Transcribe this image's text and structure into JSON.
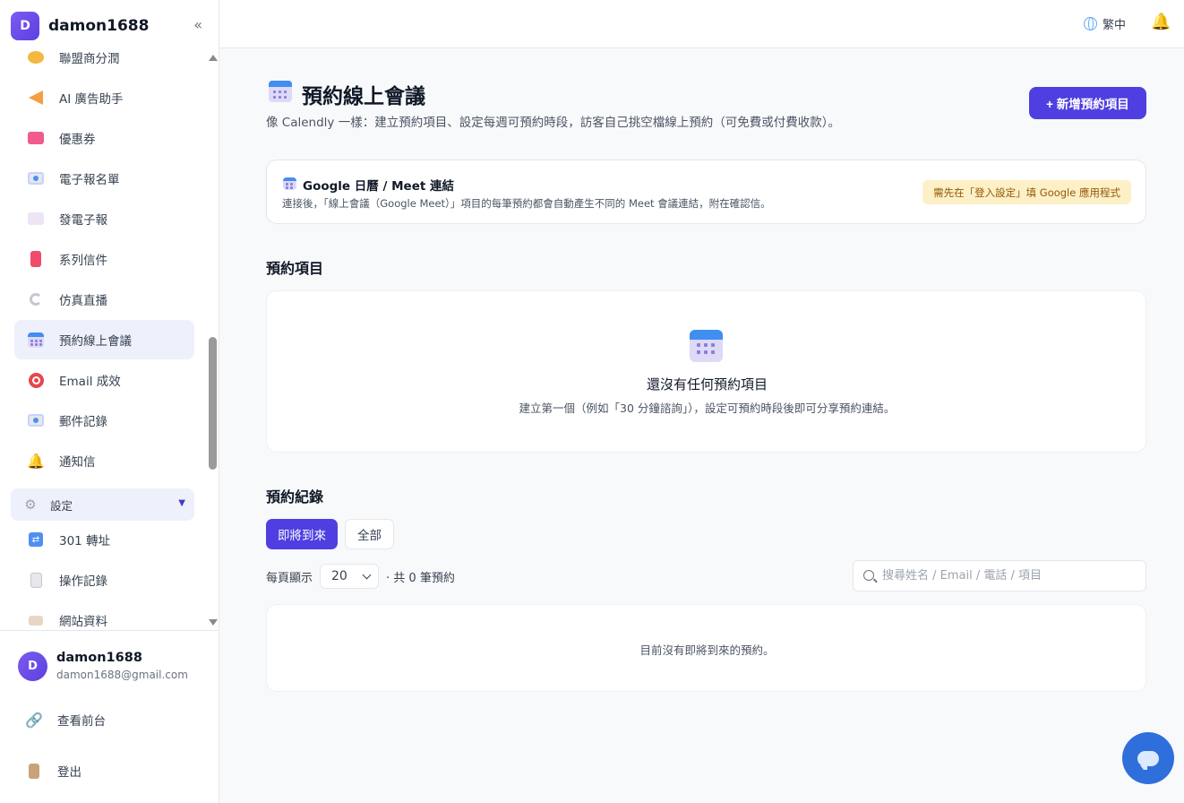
{
  "brand": {
    "initial": "D",
    "name": "damon1688"
  },
  "sidebar": {
    "items": [
      {
        "label": "聯盟商分潤",
        "icon": "handshake-icon",
        "color": "#f4b740"
      },
      {
        "label": "AI 廣告助手",
        "icon": "megaphone-icon",
        "color": "#f59e42"
      },
      {
        "label": "優惠券",
        "icon": "ticket-icon",
        "color": "#ef5b8c"
      },
      {
        "label": "電子報名單",
        "icon": "email-list-icon",
        "color": "#8ab4f8"
      },
      {
        "label": "發電子報",
        "icon": "envelope-icon",
        "color": "#e9d5f5"
      },
      {
        "label": "系列信件",
        "icon": "mailbox-icon",
        "color": "#ef4b6b"
      },
      {
        "label": "仿真直播",
        "icon": "satellite-icon",
        "color": "#9ca3af"
      },
      {
        "label": "預約線上會議",
        "icon": "calendar-icon",
        "color": "#6c6fe6",
        "active": true
      },
      {
        "label": "Email 成效",
        "icon": "target-icon",
        "color": "#e5484d"
      },
      {
        "label": "郵件記錄",
        "icon": "email-log-icon",
        "color": "#8ab4f8"
      },
      {
        "label": "通知信",
        "icon": "bell-icon",
        "color": "#f5b014"
      }
    ],
    "group": {
      "label": "設定",
      "icon": "gear-icon"
    },
    "sub_items": [
      {
        "label": "301 轉址",
        "icon": "shuffle-icon",
        "color": "#4f8ff0"
      },
      {
        "label": "操作記錄",
        "icon": "clipboard-icon",
        "color": "#9ca3af"
      },
      {
        "label": "網站資料",
        "icon": "signpost-icon",
        "color": "#c9a27a"
      }
    ]
  },
  "profile": {
    "initial": "D",
    "name": "damon1688",
    "email": "damon1688@gmail.com",
    "view_front": "查看前台",
    "logout": "登出"
  },
  "topbar": {
    "language": "繁中"
  },
  "page": {
    "title": "預約線上會議",
    "description": "像 Calendly 一樣：建立預約項目、設定每週可預約時段，訪客自己挑空檔線上預約（可免費或付費收款）。",
    "add_button": "+ 新增預約項目"
  },
  "google_card": {
    "title": "Google 日曆 / Meet 連結",
    "description": "連接後，「線上會議（Google Meet）」項目的每筆預約都會自動產生不同的 Meet 會議連結，附在確認信。",
    "badge": "需先在「登入設定」填 Google 應用程式"
  },
  "booking_items": {
    "section_title": "預約項目",
    "empty_title": "還沒有任何預約項目",
    "empty_desc": "建立第一個（例如「30 分鐘諮詢」），設定可預約時段後即可分享預約連結。"
  },
  "records": {
    "section_title": "預約紀錄",
    "tabs": [
      {
        "label": "即將到來",
        "active": true
      },
      {
        "label": "全部",
        "active": false
      }
    ],
    "per_page_label": "每頁顯示",
    "per_page_value": "20",
    "total": "· 共 0 筆預約",
    "search_placeholder": "搜尋姓名 / Email / 電話 / 項目",
    "empty": "目前沒有即將到來的預約。"
  },
  "colors": {
    "accent": "#4f3fe0",
    "badge_bg": "#fdf0c6",
    "chat": "#2f6fdc"
  }
}
